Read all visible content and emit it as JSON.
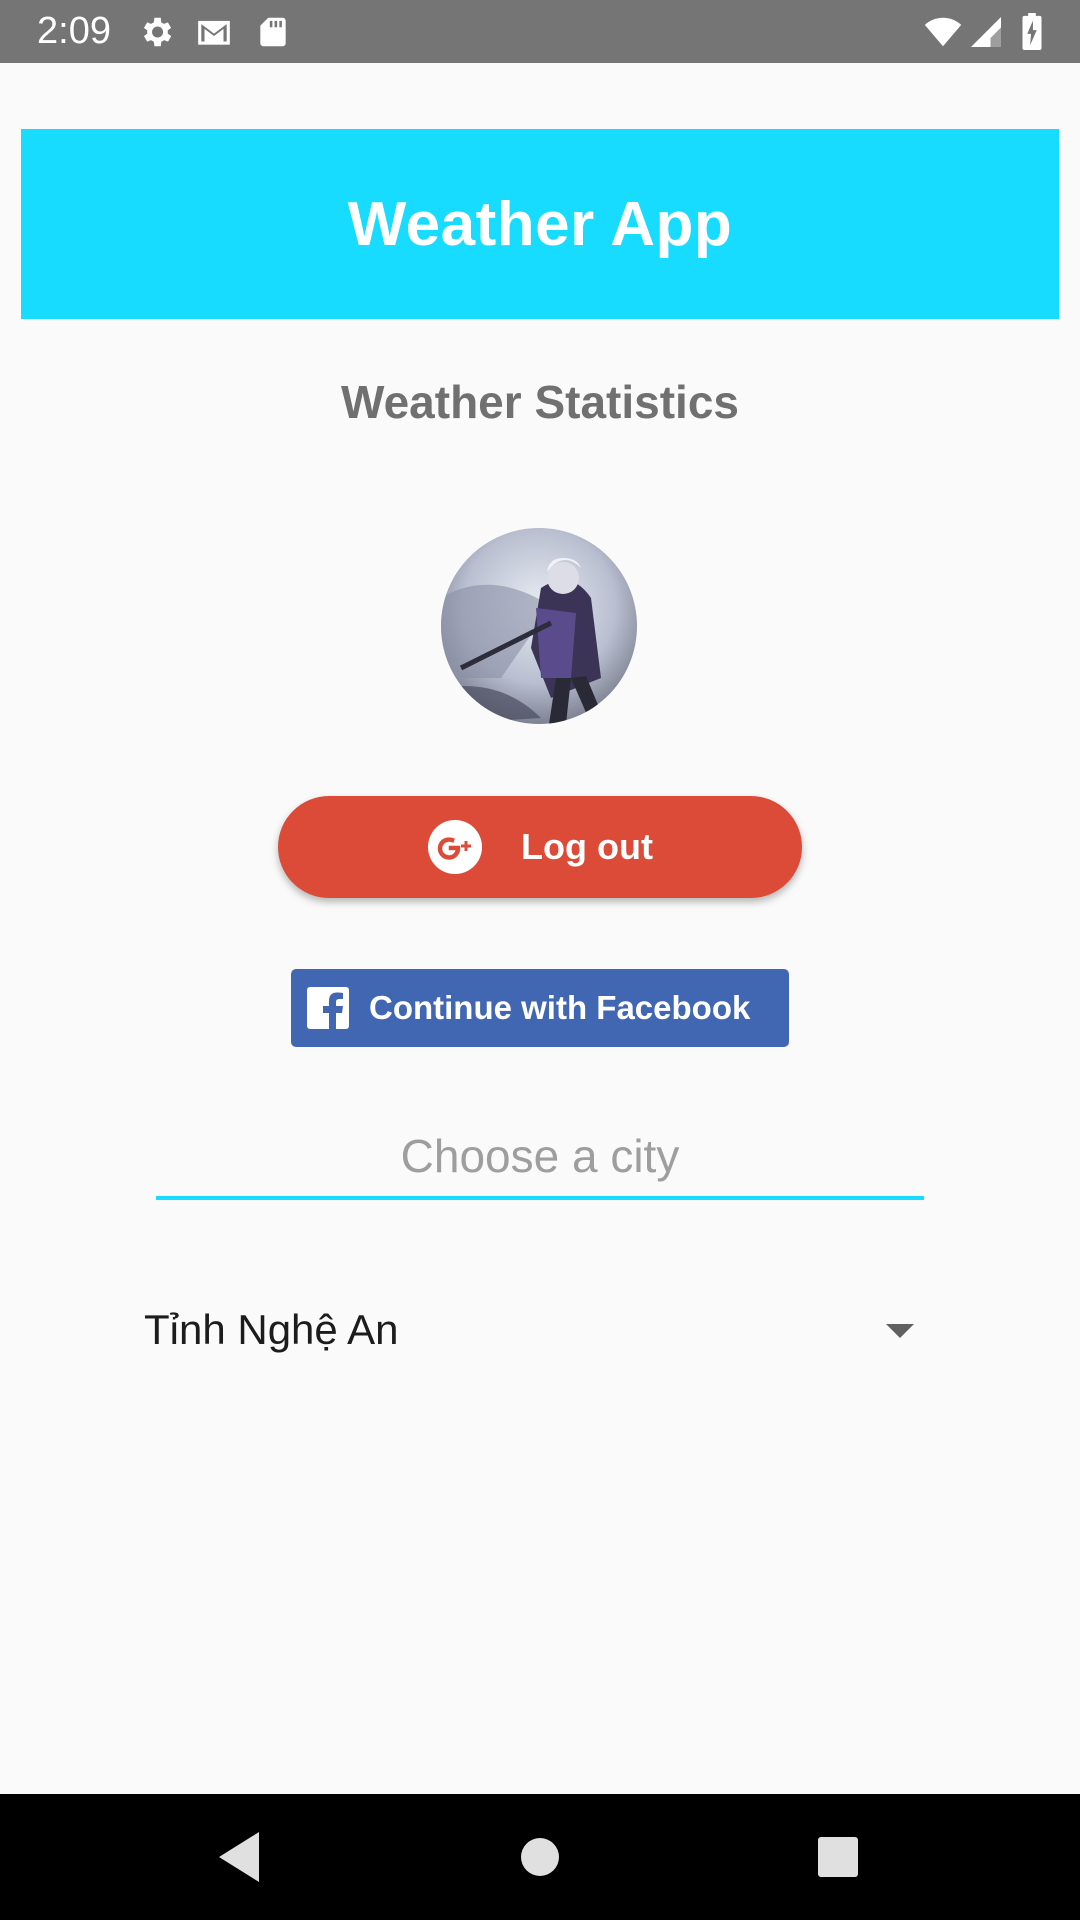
{
  "status_bar": {
    "time": "2:09",
    "left_icons": [
      "settings-icon",
      "gmail-icon",
      "sd-card-icon"
    ],
    "right_icons": [
      "wifi-icon",
      "signal-icon",
      "battery-charging-icon"
    ]
  },
  "header": {
    "title": "Weather App",
    "background_color": "#17dbff"
  },
  "main": {
    "section_title": "Weather Statistics",
    "avatar": "profile-avatar",
    "logout_button": {
      "label": "Log out",
      "icon": "google-plus-icon",
      "color": "#dc4b38"
    },
    "facebook_button": {
      "label": "Continue with Facebook",
      "icon": "facebook-icon",
      "color": "#4267b2"
    },
    "city_input": {
      "placeholder": "Choose a city",
      "value": "",
      "underline_color": "#17dbff"
    },
    "city_dropdown": {
      "selected": "Tỉnh Nghệ An"
    }
  },
  "nav_bar": {
    "buttons": [
      "back-icon",
      "home-icon",
      "recents-icon"
    ]
  }
}
